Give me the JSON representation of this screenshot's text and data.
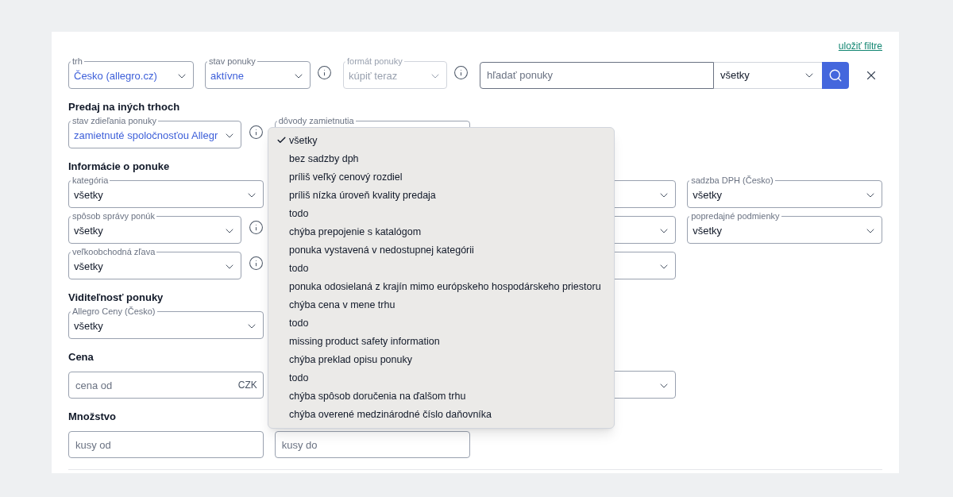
{
  "save_filters_link": "uložiť filtre",
  "top_row": [
    {
      "kind": "select",
      "label": "trh",
      "value": "Česko (allegro.cz)",
      "highlighted": true,
      "disabled": false,
      "info": false
    },
    {
      "kind": "select",
      "label": "stav ponuky",
      "value": "aktívne",
      "highlighted": true,
      "disabled": false,
      "info": true
    },
    {
      "kind": "select",
      "label": "formát ponuky",
      "value": "kúpiť teraz",
      "highlighted": false,
      "disabled": true,
      "info": true
    }
  ],
  "search": {
    "placeholder": "hľadať ponuky",
    "scope": "všetky"
  },
  "sections": [
    {
      "title": "Predaj na iných trhoch",
      "rows": [
        [
          {
            "kind": "select",
            "label": "stav zdieľania ponuky",
            "value": "zamietnuté spoločnosťou Allegr",
            "highlighted": true,
            "info": true
          },
          {
            "kind": "covered_select",
            "label": "dôvody zamietnutia"
          }
        ]
      ]
    },
    {
      "title": "Informácie o ponuke",
      "rows": [
        [
          {
            "kind": "select",
            "label": "kategória",
            "value": "všetky",
            "highlighted": false,
            "info": false
          },
          {
            "kind": "covered"
          },
          {
            "kind": "covered_select"
          },
          {
            "kind": "select",
            "label": "sadzba DPH (Česko)",
            "value": "všetky",
            "highlighted": false,
            "info": false
          }
        ],
        [
          {
            "kind": "select",
            "label": "spôsob správy ponúk",
            "value": "všetky",
            "highlighted": false,
            "info": true
          },
          {
            "kind": "covered"
          },
          {
            "kind": "covered_select"
          },
          {
            "kind": "select",
            "label": "popredajné podmienky",
            "value": "všetky",
            "highlighted": false,
            "info": false
          }
        ],
        [
          {
            "kind": "select",
            "label": "veľkoobchodná zľava",
            "value": "všetky",
            "highlighted": false,
            "info": true
          },
          {
            "kind": "covered"
          },
          {
            "kind": "covered_select"
          }
        ]
      ]
    },
    {
      "title": "Viditeľnosť ponuky",
      "rows": [
        [
          {
            "kind": "select",
            "label": "Allegro Ceny (Česko)",
            "value": "všetky",
            "highlighted": false,
            "info": false
          }
        ]
      ]
    },
    {
      "title": "Cena",
      "rows": [
        [
          {
            "kind": "input",
            "placeholder": "cena od",
            "suffix": "CZK"
          },
          {
            "kind": "covered"
          },
          {
            "kind": "covered_select"
          }
        ]
      ]
    },
    {
      "title": "Množstvo",
      "rows": [
        [
          {
            "kind": "input",
            "placeholder": "kusy od"
          },
          {
            "kind": "input",
            "placeholder": "kusy do"
          }
        ]
      ]
    }
  ],
  "dropdown": {
    "options": [
      {
        "label": "všetky",
        "selected": true
      },
      {
        "label": "bez sadzby dph",
        "selected": false
      },
      {
        "label": "príliš veľký cenový rozdiel",
        "selected": false
      },
      {
        "label": "príliš nízka úroveň kvality predaja",
        "selected": false
      },
      {
        "label": "todo",
        "selected": false
      },
      {
        "label": "chýba prepojenie s katalógom",
        "selected": false
      },
      {
        "label": "ponuka vystavená v nedostupnej kategórii",
        "selected": false
      },
      {
        "label": "todo",
        "selected": false
      },
      {
        "label": "ponuka odosielaná z krajín mimo európskeho hospodárskeho priestoru",
        "selected": false
      },
      {
        "label": "chýba cena v mene trhu",
        "selected": false
      },
      {
        "label": "todo",
        "selected": false
      },
      {
        "label": "missing product safety information",
        "selected": false
      },
      {
        "label": "chýba preklad opisu ponuky",
        "selected": false
      },
      {
        "label": "todo",
        "selected": false
      },
      {
        "label": "chýba spôsob doručenia na ďalšom trhu",
        "selected": false
      },
      {
        "label": "chýba overené medzinárodné číslo daňovníka",
        "selected": false
      }
    ]
  }
}
